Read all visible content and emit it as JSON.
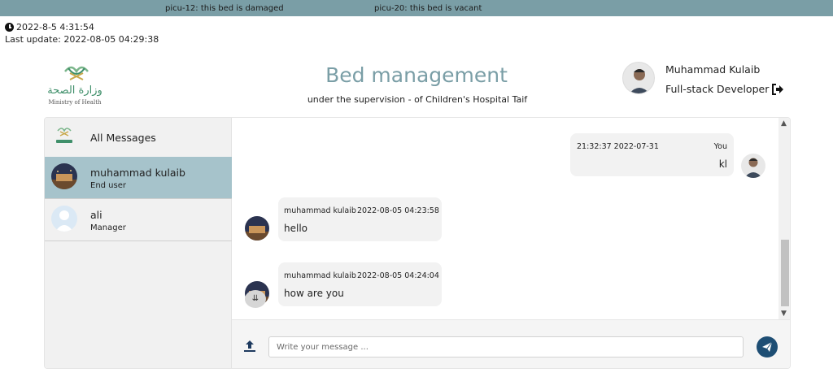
{
  "ticker": {
    "items": [
      "picu-12: this bed is damaged",
      "picu-20: this bed is vacant"
    ]
  },
  "header": {
    "clock": "2022-8-5 4:31:54",
    "last_update": "Last update: 2022-08-05 04:29:38",
    "title": "Bed management",
    "subtitle": "under the supervision - of Children's Hospital Taif",
    "logo_arabic": "وزارة الصحة",
    "logo_english": "Ministry of Health"
  },
  "profile": {
    "name": "Muhammad Kulaib",
    "role": "Full-stack Developer"
  },
  "contacts": [
    {
      "name": "All Messages",
      "role": ""
    },
    {
      "name": "muhammad kulaib",
      "role": "End user"
    },
    {
      "name": "ali",
      "role": "Manager"
    }
  ],
  "messages": [
    {
      "sender": "You",
      "time": "21:32:37 2022-07-31",
      "text": "kl"
    },
    {
      "sender": "muhammad kulaib",
      "time": "2022-08-05 04:23:58",
      "text": "hello"
    },
    {
      "sender": "muhammad kulaib",
      "time": "2022-08-05 04:24:04",
      "text": "how are you"
    }
  ],
  "composer": {
    "placeholder": "Write your message ..."
  },
  "colors": {
    "ticker": "#7a9ea6",
    "accent": "#7a9ea6",
    "active_contact": "#a6c3cb",
    "send_button": "#1e4e74"
  }
}
